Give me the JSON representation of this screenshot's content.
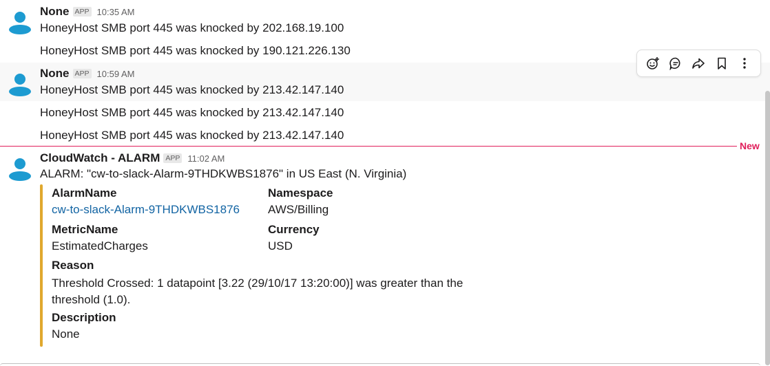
{
  "messages": [
    {
      "sender": "None",
      "badge": "APP",
      "time": "10:35 AM",
      "lines": [
        "HoneyHost SMB port 445 was knocked by 202.168.19.100",
        "HoneyHost SMB port 445 was knocked by 190.121.226.130"
      ]
    },
    {
      "sender": "None",
      "badge": "APP",
      "time": "10:59 AM",
      "lines": [
        "HoneyHost SMB port 445 was knocked by 213.42.147.140",
        "HoneyHost SMB port 445 was knocked by 213.42.147.140",
        "HoneyHost SMB port 445 was knocked by 213.42.147.140"
      ]
    },
    {
      "sender": "CloudWatch - ALARM",
      "badge": "APP",
      "time": "11:02 AM",
      "text": "ALARM: \"cw-to-slack-Alarm-9THDKWBS1876\" in US East (N. Virginia)",
      "attachment": {
        "color": "#e0a82e",
        "fields": {
          "alarm_name_title": "AlarmName",
          "alarm_name_value": "cw-to-slack-Alarm-9THDKWBS1876",
          "namespace_title": "Namespace",
          "namespace_value": "AWS/Billing",
          "metric_name_title": "MetricName",
          "metric_name_value": "EstimatedCharges",
          "currency_title": "Currency",
          "currency_value": "USD",
          "reason_title": "Reason",
          "reason_value": "Threshold Crossed: 1 datapoint [3.22 (29/10/17 13:20:00)] was greater than the threshold (1.0).",
          "description_title": "Description",
          "description_value": "None"
        }
      }
    }
  ],
  "divider": {
    "label": "New",
    "color": "#e01e5a"
  },
  "toolbar_icons": [
    "add-reaction-icon",
    "reply-in-thread-icon",
    "share-icon",
    "bookmark-icon",
    "more-actions-icon"
  ],
  "colors": {
    "link": "#1264a3",
    "muted": "#616061"
  }
}
